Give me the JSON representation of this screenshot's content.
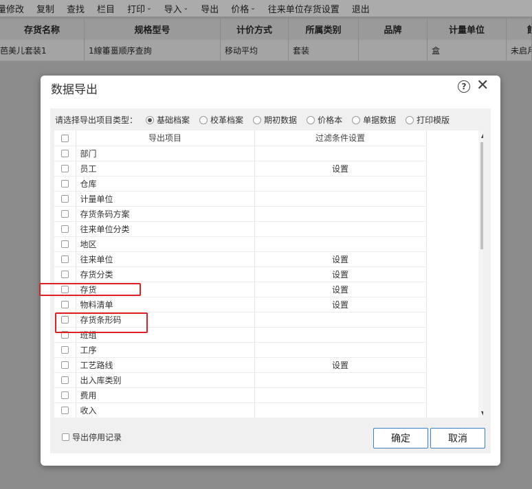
{
  "toolbar": {
    "items": [
      {
        "label": "量修改"
      },
      {
        "label": "复制"
      },
      {
        "label": "查找"
      },
      {
        "label": "栏目"
      },
      {
        "label": "打印",
        "caret": "⌄"
      },
      {
        "label": "导入",
        "caret": "⌄"
      },
      {
        "label": "导出"
      },
      {
        "label": "价格",
        "caret": "⌄"
      },
      {
        "label": "往来单位存货设置"
      },
      {
        "label": "退出"
      }
    ]
  },
  "grid": {
    "headers": [
      "存货名称",
      "规格型号",
      "计价方式",
      "所属类别",
      "品牌",
      "计量单位",
      "館"
    ],
    "row": [
      "芭美儿套装1",
      "1線箠畺顺序查詢",
      "移动平均",
      "套装",
      "",
      "盒",
      "未启月"
    ]
  },
  "dialog": {
    "title": "数据导出",
    "help_glyph": "?",
    "close_glyph": "✕",
    "type_label": "请选择导出项目类型：",
    "types": [
      {
        "label": "基础档案",
        "checked": true
      },
      {
        "label": "校革档案",
        "checked": false
      },
      {
        "label": "期初数据",
        "checked": false
      },
      {
        "label": "价格本",
        "checked": false
      },
      {
        "label": "单据数据",
        "checked": false
      },
      {
        "label": "打印模版",
        "checked": false
      }
    ],
    "columns": {
      "item": "导出项目",
      "filter": "过滤条件设置"
    },
    "rows": [
      {
        "name": "部门",
        "filter": ""
      },
      {
        "name": "员工",
        "filter": "设置"
      },
      {
        "name": "仓库",
        "filter": ""
      },
      {
        "name": "计量单位",
        "filter": ""
      },
      {
        "name": "存货条码方案",
        "filter": ""
      },
      {
        "name": "往来单位分类",
        "filter": ""
      },
      {
        "name": "地区",
        "filter": ""
      },
      {
        "name": "往来单位",
        "filter": "设置"
      },
      {
        "name": "存货分类",
        "filter": "设置"
      },
      {
        "name": "存货",
        "filter": "设置"
      },
      {
        "name": "物料清单",
        "filter": "设置"
      },
      {
        "name": "存货条形码",
        "filter": ""
      },
      {
        "name": "班组",
        "filter": ""
      },
      {
        "name": "工序",
        "filter": ""
      },
      {
        "name": "工艺路线",
        "filter": "设置"
      },
      {
        "name": "出入库类别",
        "filter": ""
      },
      {
        "name": "费用",
        "filter": ""
      },
      {
        "name": "收入",
        "filter": ""
      }
    ],
    "scroll_up_glyph": "▲",
    "scroll_down_glyph": "▼",
    "export_disabled_label": "导出停用记录",
    "ok_label": "确定",
    "cancel_label": "取消"
  },
  "colors": {
    "highlight": "#e02020",
    "button_border": "#3a7fc1"
  }
}
